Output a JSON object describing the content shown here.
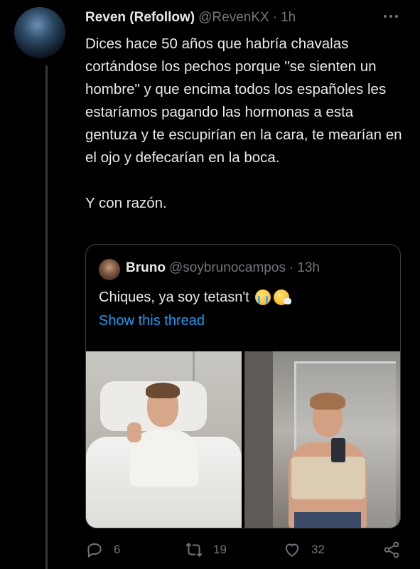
{
  "tweet": {
    "author_name": "Reven (Refollow)",
    "handle": "@RevenKX",
    "separator": "·",
    "time": "1h",
    "text": "Dices hace 50 años que habría chavalas cortándose los pechos porque \"se sienten un hombre\" y que encima todos los españoles les estaríamos pagando las hormonas a esta gentuza y te escupirían en la cara, te mearían en el ojo y defecarían en la boca.\n\nY con razón.",
    "icons": {
      "more": "more-horizontal-icon"
    }
  },
  "quoted": {
    "author_name": "Bruno",
    "handle": "@soybrunocampos",
    "separator": "·",
    "time": "13h",
    "text": "Chiques, ya soy tetasn't",
    "emojis": [
      "loudly-crying-face",
      "sneezing-face"
    ],
    "link": "Show this thread",
    "link_color": "#1d9bf0",
    "photos": [
      "hospital-bed-thumbs-up",
      "mirror-selfie-chest-binder"
    ]
  },
  "actions": {
    "replies": "6",
    "retweets": "19",
    "likes": "32",
    "icons": [
      "reply-icon",
      "retweet-icon",
      "like-icon",
      "share-icon"
    ]
  },
  "colors": {
    "background": "#000000",
    "text": "#e7e9ea",
    "muted": "#71767b",
    "accent": "#1d9bf0",
    "border": "#3c4043"
  }
}
